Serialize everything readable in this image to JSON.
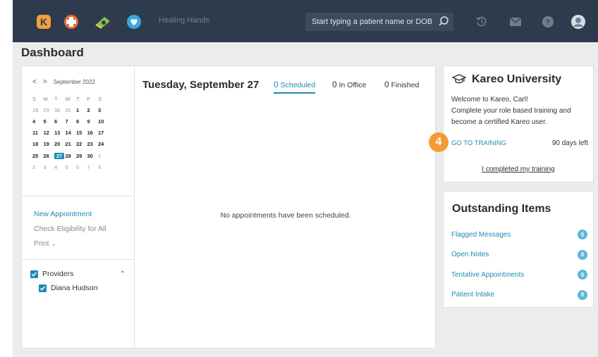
{
  "header": {
    "org_name": "Healing Hands",
    "search_placeholder": "Start typing a patient name or DOB",
    "brand_letter": "K",
    "icons": [
      "kareo-logo-icon",
      "medical-cross-icon",
      "billing-icon",
      "heart-icon",
      "search-icon",
      "history-icon",
      "mail-icon",
      "help-icon",
      "avatar-icon"
    ],
    "colors": {
      "bar": "#2e3b4c",
      "logo": "#f2a03a",
      "cross": "#e86a3c",
      "billing": "#8bc34a",
      "heart": "#3aa8e0"
    }
  },
  "page_title": "Dashboard",
  "calendar": {
    "prev": "<",
    "next": ">",
    "month_label": "September 2022",
    "weekdays": [
      "S",
      "M",
      "T",
      "W",
      "T",
      "F",
      "S"
    ],
    "weeks": [
      [
        "28",
        "29",
        "30",
        "31",
        "1",
        "2",
        "3"
      ],
      [
        "4",
        "5",
        "6",
        "7",
        "8",
        "9",
        "10"
      ],
      [
        "11",
        "12",
        "13",
        "14",
        "15",
        "16",
        "17"
      ],
      [
        "18",
        "19",
        "20",
        "21",
        "22",
        "23",
        "24"
      ],
      [
        "25",
        "26",
        "27",
        "28",
        "29",
        "30",
        "1"
      ],
      [
        "2",
        "3",
        "4",
        "5",
        "6",
        "7",
        "8"
      ]
    ],
    "selected_day": "27"
  },
  "sidebar": {
    "new_appointment": "New Appointment",
    "check_eligibility": "Check Eligibility for All",
    "print": "Print",
    "providers_label": "Providers",
    "provider": "Diana Hudson"
  },
  "schedule": {
    "date": "Tuesday, September 27",
    "tabs": [
      {
        "count": "0",
        "label": "Scheduled"
      },
      {
        "count": "0",
        "label": "In Office"
      },
      {
        "count": "0",
        "label": "Finished"
      }
    ],
    "empty_message": "No appointments have been scheduled."
  },
  "university": {
    "title": "Kareo University",
    "line1": "Welcome to Kareo, Carl!",
    "line2": "Complete your role based training and become a certified Kareo user.",
    "go_to_training": "GO TO TRAINING",
    "days_left": "90 days left",
    "completed": "I completed my training",
    "step_badge": "4"
  },
  "outstanding": {
    "title": "Outstanding Items",
    "items": [
      {
        "label": "Flagged Messages",
        "count": "0"
      },
      {
        "label": "Open Notes",
        "count": "0"
      },
      {
        "label": "Tentative Appointments",
        "count": "0"
      },
      {
        "label": "Patient Intake",
        "count": "0"
      }
    ]
  }
}
